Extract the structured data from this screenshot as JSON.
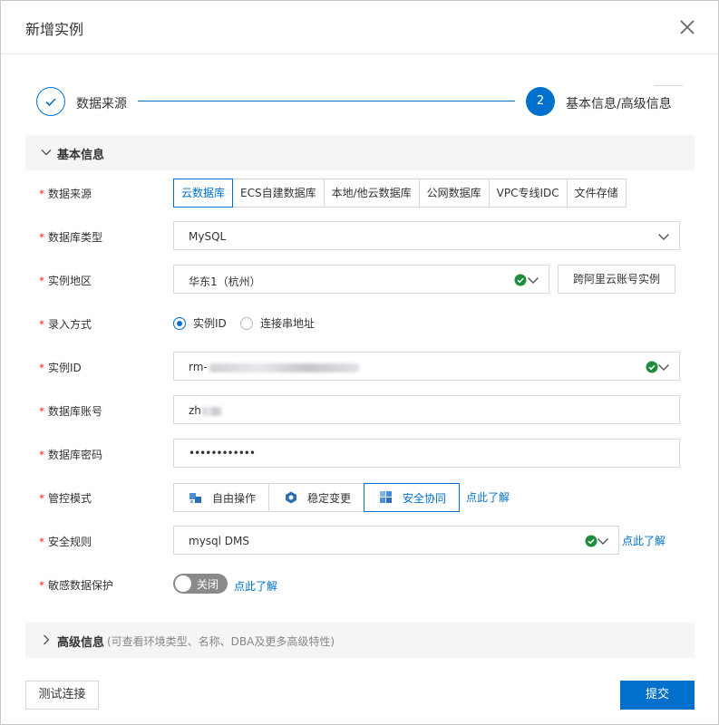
{
  "dialog": {
    "title": "新增实例"
  },
  "steps": [
    {
      "label": "数据来源",
      "state": "done"
    },
    {
      "number": "2",
      "label": "基本信息/高级信息",
      "state": "active"
    }
  ],
  "basic_section": {
    "title": "基本信息"
  },
  "form": {
    "data_source": {
      "label": "数据来源",
      "options": [
        "云数据库",
        "ECS自建数据库",
        "本地/他云数据库",
        "公网数据库",
        "VPC专线IDC",
        "文件存储"
      ],
      "selected": "云数据库"
    },
    "db_type": {
      "label": "数据库类型",
      "value": "MySQL"
    },
    "region": {
      "label": "实例地区",
      "value": "华东1（杭州）",
      "cross_account_button": "跨阿里云账号实例"
    },
    "entry_method": {
      "label": "录入方式",
      "options": [
        "实例ID",
        "连接串地址"
      ],
      "selected": "实例ID"
    },
    "instance_id": {
      "label": "实例ID",
      "value_prefix": "rm-"
    },
    "db_account": {
      "label": "数据库账号",
      "value_prefix": "zh"
    },
    "db_password": {
      "label": "数据库密码",
      "value": "••••••••••••"
    },
    "control_mode": {
      "label": "管控模式",
      "options": [
        "自由操作",
        "稳定变更",
        "安全协同"
      ],
      "selected": "安全协同",
      "learn_more": "点此了解"
    },
    "security_rule": {
      "label": "安全规则",
      "value": "mysql DMS",
      "learn_more": "点此了解"
    },
    "sensitive_data": {
      "label": "敏感数据保护",
      "toggle_label": "关闭",
      "enabled": false,
      "learn_more": "点此了解"
    }
  },
  "advanced_section": {
    "title": "高级信息",
    "hint": "(可查看环境类型、名称、DBA及更多高级特性)"
  },
  "footer": {
    "test_button": "测试连接",
    "submit_button": "提交"
  },
  "colors": {
    "accent": "#0070cc",
    "success": "#1e8e3e",
    "required": "#d93026"
  }
}
